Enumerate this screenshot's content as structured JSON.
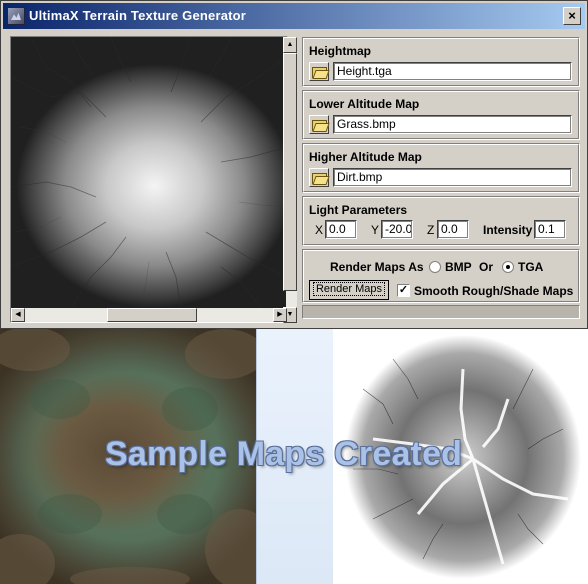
{
  "window": {
    "title": "UltimaX Terrain Texture Generator",
    "close_label": "×"
  },
  "heightmap": {
    "title": "Heightmap",
    "file": "Height.tga"
  },
  "lower_altitude": {
    "title": "Lower Altitude Map",
    "file": "Grass.bmp"
  },
  "higher_altitude": {
    "title": "Higher Altitude Map",
    "file": "Dirt.bmp"
  },
  "light": {
    "title": "Light Parameters",
    "x_label": "X",
    "x_value": "0.0",
    "y_label": "Y",
    "y_value": "-20.0",
    "z_label": "Z",
    "z_value": "0.0",
    "intensity_label": "Intensity",
    "intensity_value": "0.1"
  },
  "render": {
    "format_label": "Render Maps As",
    "bmp_label": "BMP",
    "or_label": "Or",
    "tga_label": "TGA",
    "selected_format": "TGA",
    "button_label": "Render Maps",
    "smooth_label": "Smooth Rough/Shade Maps",
    "smooth_checked": true,
    "check_mark": "✓"
  },
  "samples": {
    "caption": "Sample Maps Created"
  },
  "colors": {
    "titlebar_start": "#0a246a",
    "titlebar_end": "#a6caf0",
    "face": "#d4d0c8",
    "caption_fill": "#aac2e8"
  }
}
